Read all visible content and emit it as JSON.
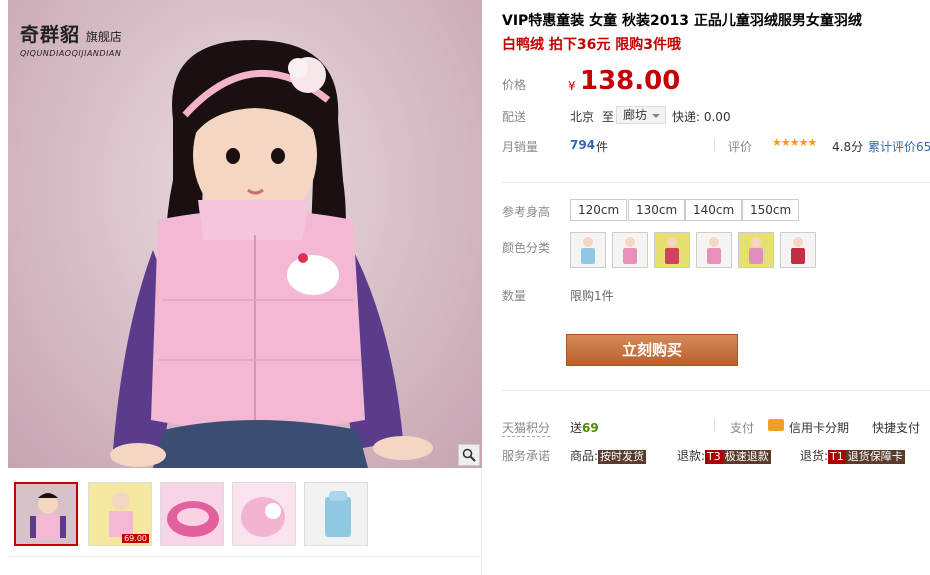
{
  "brand": {
    "name": "奇群貂",
    "shop": "旗舰店",
    "pinyin": "QIQUNDIAOQIJIANDIAN"
  },
  "product": {
    "title": "VIP特惠童装 女童 秋装2013 正品儿童羽绒服男女童羽绒",
    "subtitle": "白鸭绒 拍下36元 限购3件哦"
  },
  "price": {
    "label": "价格",
    "currency": "¥",
    "value": "138.00"
  },
  "shipping": {
    "label": "配送",
    "from": "北京",
    "to_word": "至",
    "to": "廊坊",
    "fee": "快递: 0.00"
  },
  "sales": {
    "label": "月销量",
    "count": "794",
    "unit": "件"
  },
  "reviews": {
    "label": "评价",
    "stars": "★★★★★",
    "score": "4.8分",
    "count_text": "累计评价65"
  },
  "sizes": {
    "label": "参考身高",
    "options": [
      "120cm",
      "130cm",
      "140cm",
      "150cm"
    ]
  },
  "colors": {
    "label": "颜色分类",
    "swatch_colors": [
      "#8fc8e0",
      "#e890b8",
      "#d04060",
      "#e890b8",
      "#e090c0",
      "#c03040"
    ]
  },
  "quantity": {
    "label": "数量",
    "limit": "限购1件"
  },
  "buy_button": "立刻购买",
  "points": {
    "label": "天猫积分",
    "prefix": "送",
    "value": "69"
  },
  "payment": {
    "label": "支付",
    "card": "信用卡分期",
    "quick": "快捷支付"
  },
  "service": {
    "label": "服务承诺",
    "items": [
      {
        "prefix": "商品:",
        "badge": "按时发货"
      },
      {
        "prefix": "退款:",
        "code": "T3",
        "badge": "极速退款"
      },
      {
        "prefix": "退货:",
        "code": "T1",
        "badge": "退货保障卡"
      }
    ]
  },
  "thumbnails": {
    "count_tag": "69.00"
  },
  "colors_theme": {
    "price_red": "#c40000",
    "link_blue": "#3366aa",
    "buy_orange": "#c0703a"
  }
}
